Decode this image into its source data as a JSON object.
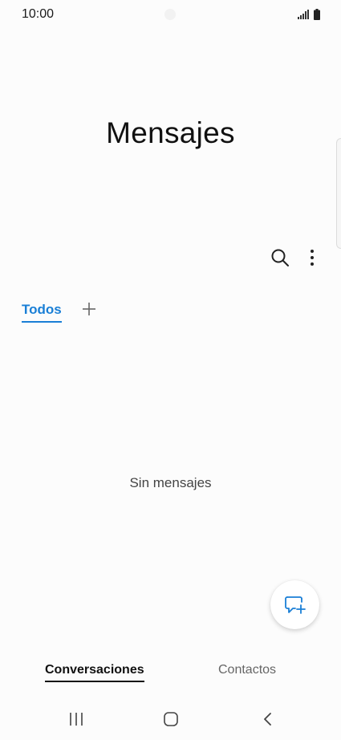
{
  "status_bar": {
    "time": "10:00",
    "icons": [
      "signal-icon",
      "battery-icon"
    ]
  },
  "header": {
    "title": "Mensajes"
  },
  "toolbar": {
    "icons": [
      "search-icon",
      "more-vert-icon"
    ]
  },
  "tabs": {
    "items": [
      {
        "label": "Todos",
        "active": true
      }
    ],
    "add_icon": "plus-icon"
  },
  "empty_state": {
    "text": "Sin mensajes"
  },
  "fab": {
    "icon": "new-message-icon"
  },
  "bottom_tabs": {
    "items": [
      {
        "label": "Conversaciones",
        "active": true
      },
      {
        "label": "Contactos",
        "active": false
      }
    ]
  },
  "nav_bar": {
    "icons": [
      "recent-apps-icon",
      "home-icon",
      "back-icon"
    ]
  },
  "colors": {
    "accent": "#1a7fd6",
    "background": "#fcfcfc",
    "text": "#111111",
    "muted": "#666666"
  }
}
